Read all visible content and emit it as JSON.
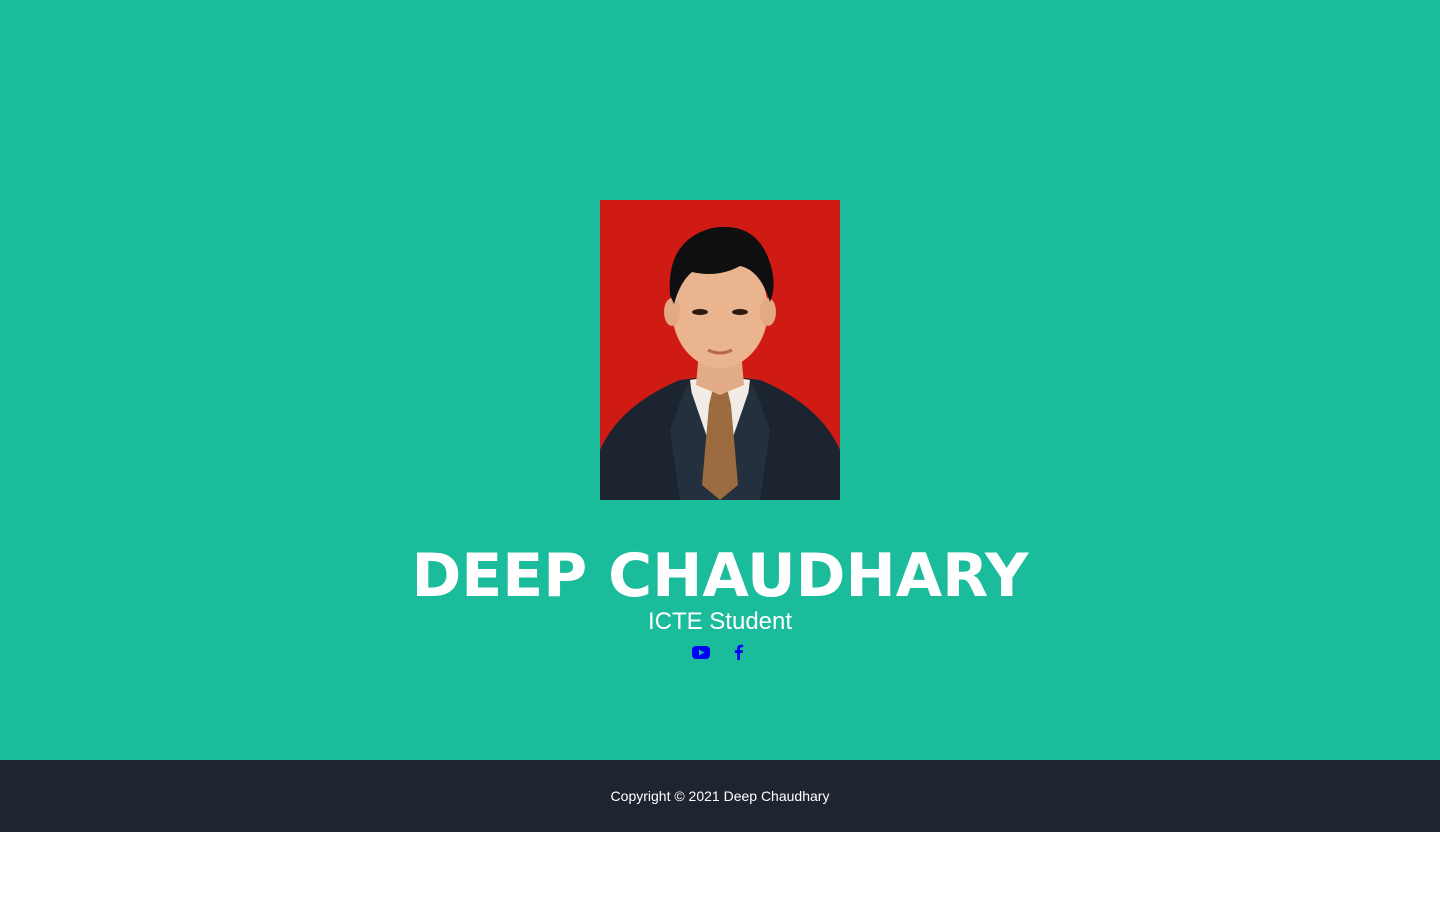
{
  "colors": {
    "hero_bg": "#1abc9c",
    "footer_bg": "#1e2530",
    "text": "#ffffff",
    "social_icon": "#0000ff",
    "photo_bg": "#d01a14"
  },
  "profile": {
    "name": "DEEP CHAUDHARY",
    "role": "ICTE Student"
  },
  "socials": [
    {
      "icon": "youtube-icon"
    },
    {
      "icon": "facebook-icon"
    }
  ],
  "footer": {
    "copyright": "Copyright © 2021 Deep Chaudhary"
  }
}
